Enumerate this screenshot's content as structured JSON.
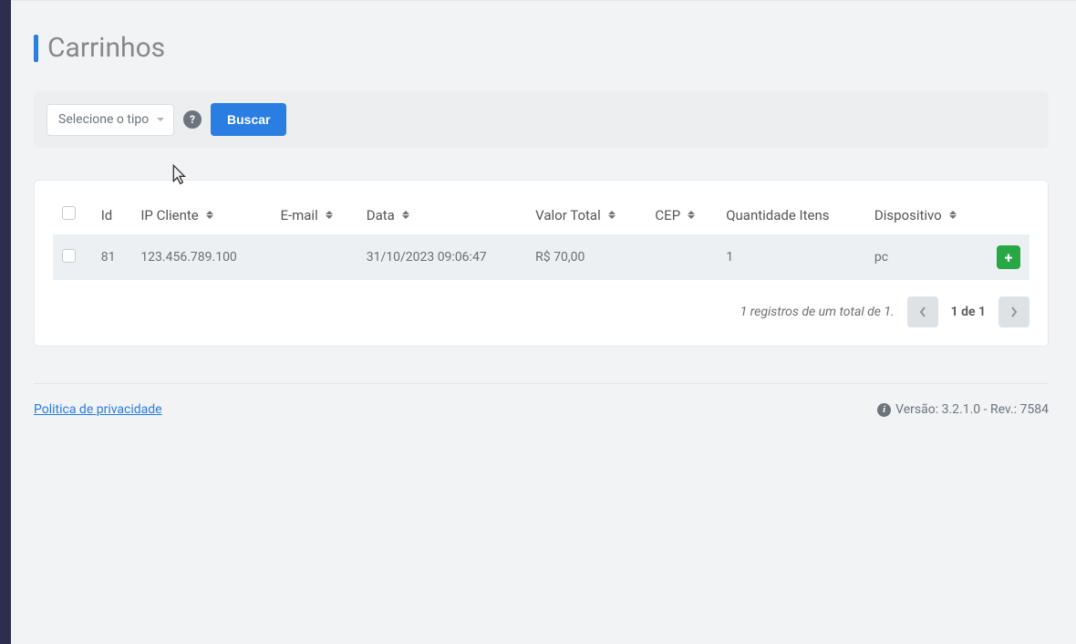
{
  "page": {
    "title": "Carrinhos"
  },
  "filter": {
    "type_placeholder": "Selecione o tipo",
    "help_symbol": "?",
    "search_label": "Buscar"
  },
  "table": {
    "headers": {
      "id": "Id",
      "ip_cliente": "IP Cliente",
      "email": "E-mail",
      "data": "Data",
      "valor_total": "Valor Total",
      "cep": "CEP",
      "quantidade_itens": "Quantidade Itens",
      "dispositivo": "Dispositivo"
    },
    "rows": [
      {
        "id": "81",
        "ip_cliente": "123.456.789.100",
        "email": "",
        "data": "31/10/2023 09:06:47",
        "valor_total": "R$ 70,00",
        "cep": "",
        "quantidade_itens": "1",
        "dispositivo": "pc"
      }
    ],
    "records_text": "1 registros de um total de 1.",
    "page_label": "1 de 1",
    "plus_symbol": "+"
  },
  "footer": {
    "privacy_link": "Politica de privacidade",
    "version_text": "Versão: 3.2.1.0 - Rev.: 7584"
  }
}
